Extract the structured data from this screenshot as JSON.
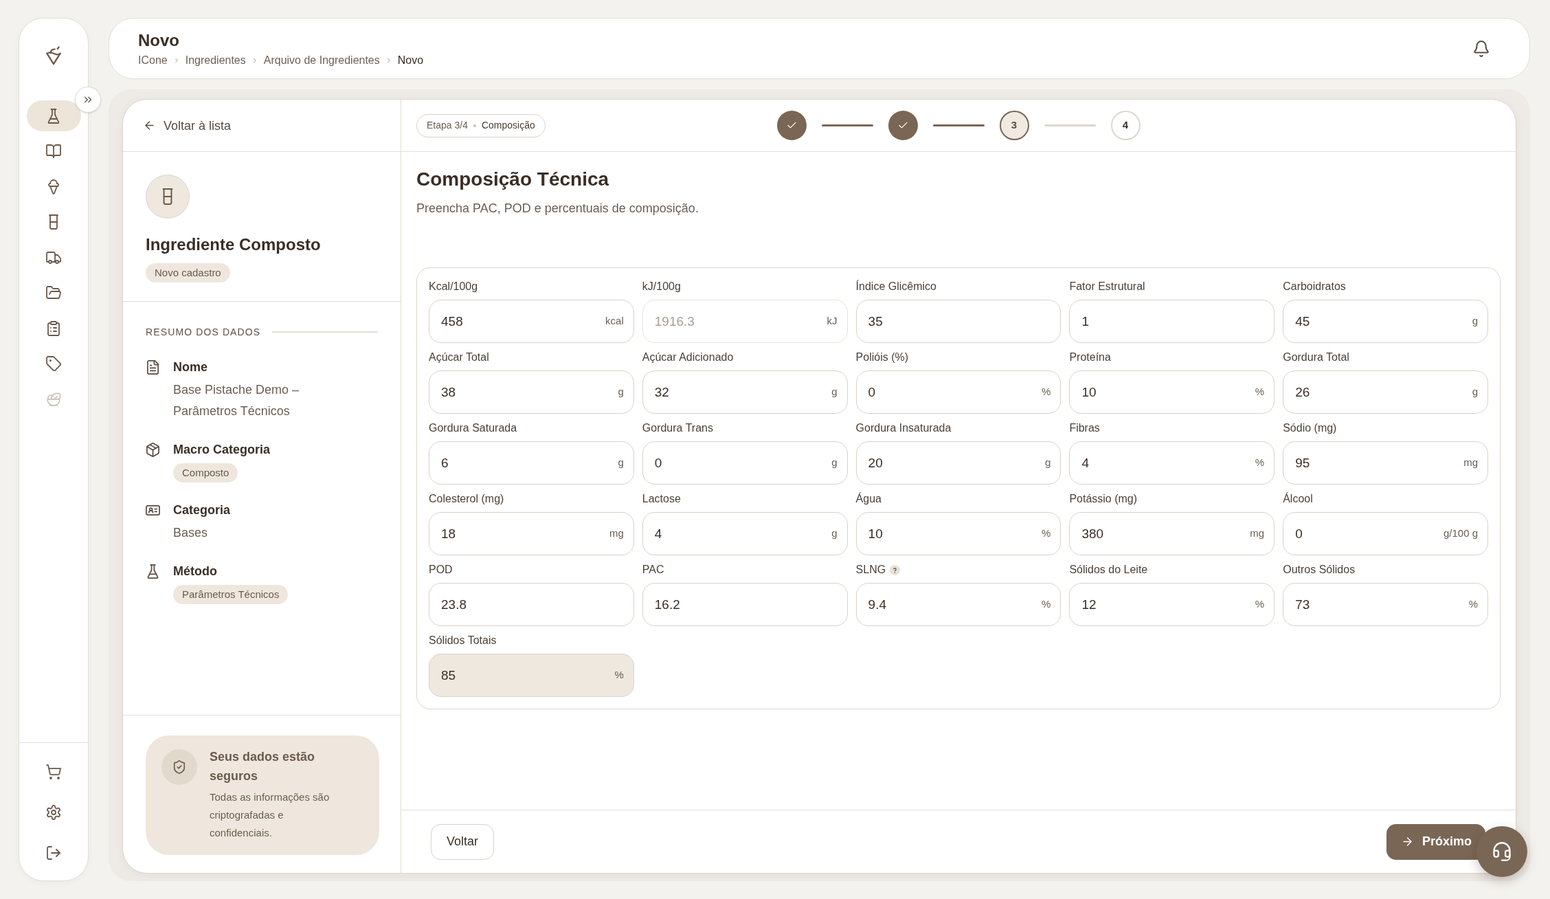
{
  "sidebar": {
    "items": [
      {
        "selected": true,
        "disabled": false
      },
      {
        "selected": false,
        "disabled": false
      },
      {
        "selected": false,
        "disabled": false
      },
      {
        "selected": false,
        "disabled": false
      },
      {
        "selected": false,
        "disabled": false
      },
      {
        "selected": false,
        "disabled": false
      },
      {
        "selected": false,
        "disabled": false
      },
      {
        "selected": false,
        "disabled": false
      },
      {
        "selected": false,
        "disabled": true
      }
    ]
  },
  "header": {
    "title": "Novo",
    "breadcrumb": [
      {
        "label": "ICone",
        "current": false
      },
      {
        "label": "Ingredientes",
        "current": false
      },
      {
        "label": "Arquivo de Ingredientes",
        "current": false
      },
      {
        "label": "Novo",
        "current": true
      }
    ]
  },
  "left_panel": {
    "back_link": "Voltar à lista",
    "title": "Ingrediente Composto",
    "badge": "Novo cadastro",
    "summary": {
      "heading": "RESUMO DOS DADOS",
      "items": [
        {
          "label": "Nome",
          "value": "Base Pistache Demo – Parâmetros Técnicos",
          "kind": "text"
        },
        {
          "label": "Macro Categoria",
          "value": "Composto",
          "kind": "badge"
        },
        {
          "label": "Categoria",
          "value": "Bases",
          "kind": "text"
        },
        {
          "label": "Método",
          "value": "Parâmetros Técnicos",
          "kind": "badge"
        }
      ]
    },
    "security_note": {
      "title": "Seus dados estão seguros",
      "text": "Todas as informações são criptografadas e confidenciais."
    }
  },
  "wizard": {
    "badge": {
      "step": "Etapa 3/4",
      "name": "Composição"
    },
    "steps": [
      {
        "done": true,
        "selected": false
      },
      {
        "done": true,
        "selected": false
      },
      {
        "done": false,
        "selected": true,
        "number": "3"
      },
      {
        "done": false,
        "selected": false,
        "number": "4"
      }
    ]
  },
  "content": {
    "title": "Composição Técnica",
    "subtitle": "Preencha PAC, POD e percentuais de composição.",
    "fields": [
      {
        "kind": "input",
        "label": "Kcal/100g",
        "value": "458",
        "unit": "kcal",
        "disabled": false,
        "readonly": false
      },
      {
        "kind": "input",
        "label": "kJ/100g",
        "value": "1916.3",
        "unit": "kJ",
        "disabled": true,
        "readonly": false
      },
      {
        "kind": "input",
        "label": "Índice Glicêmico",
        "value": "35",
        "disabled": false,
        "readonly": false
      },
      {
        "kind": "input",
        "label": "Fator Estrutural",
        "value": "1",
        "disabled": false,
        "readonly": false
      },
      {
        "kind": "input",
        "label": "Carboidratos",
        "value": "45",
        "unit": "g",
        "disabled": false,
        "readonly": false
      },
      {
        "kind": "input",
        "label": "Açúcar Total",
        "value": "38",
        "unit": "g",
        "disabled": false,
        "readonly": false
      },
      {
        "kind": "input",
        "label": "Açúcar Adicionado",
        "value": "32",
        "unit": "g",
        "disabled": false,
        "readonly": false
      },
      {
        "kind": "input",
        "label": "Polióis (%)",
        "value": "0",
        "unit": "%",
        "disabled": false,
        "readonly": false
      },
      {
        "kind": "input",
        "label": "Proteína",
        "value": "10",
        "unit": "%",
        "disabled": false,
        "readonly": false
      },
      {
        "kind": "input",
        "label": "Gordura Total",
        "value": "26",
        "unit": "g",
        "disabled": false,
        "readonly": false
      },
      {
        "kind": "input",
        "label": "Gordura Saturada",
        "value": "6",
        "unit": "g",
        "disabled": false,
        "readonly": false
      },
      {
        "kind": "input",
        "label": "Gordura Trans",
        "value": "0",
        "unit": "g",
        "disabled": false,
        "readonly": false
      },
      {
        "kind": "input",
        "label": "Gordura Insaturada",
        "value": "20",
        "unit": "g",
        "disabled": false,
        "readonly": false
      },
      {
        "kind": "input",
        "label": "Fibras",
        "value": "4",
        "unit": "%",
        "disabled": false,
        "readonly": false
      },
      {
        "kind": "input",
        "label": "Sódio (mg)",
        "value": "95",
        "unit": "mg",
        "disabled": false,
        "readonly": false
      },
      {
        "kind": "input",
        "label": "Colesterol (mg)",
        "value": "18",
        "unit": "mg",
        "disabled": false,
        "readonly": false
      },
      {
        "kind": "input",
        "label": "Lactose",
        "value": "4",
        "unit": "g",
        "disabled": false,
        "readonly": false
      },
      {
        "kind": "input",
        "label": "Água",
        "value": "10",
        "unit": "%",
        "disabled": false,
        "readonly": false
      },
      {
        "kind": "input",
        "label": "Potássio (mg)",
        "value": "380",
        "unit": "mg",
        "disabled": false,
        "readonly": false
      },
      {
        "kind": "input",
        "label": "Álcool",
        "value": "0",
        "unit": "g/100 g",
        "disabled": false,
        "readonly": false
      },
      {
        "kind": "input",
        "label": "POD",
        "value": "23.8",
        "disabled": false,
        "readonly": false
      },
      {
        "kind": "input",
        "label": "PAC",
        "value": "16.2",
        "disabled": false,
        "readonly": false
      },
      {
        "kind": "input_with_help",
        "label": "SLNG",
        "value": "9.4",
        "unit": "%",
        "disabled": false,
        "readonly": false
      },
      {
        "kind": "input",
        "label": "Sólidos do Leite",
        "value": "12",
        "unit": "%",
        "disabled": false,
        "readonly": false
      },
      {
        "kind": "input",
        "label": "Outros Sólidos",
        "value": "73",
        "unit": "%",
        "disabled": false,
        "readonly": false
      },
      {
        "kind": "input",
        "label": "Sólidos Totais",
        "value": "85",
        "unit": "%",
        "disabled": false,
        "readonly": true
      }
    ]
  },
  "footer": {
    "back_button": "Voltar",
    "next_button": "Próximo"
  }
}
